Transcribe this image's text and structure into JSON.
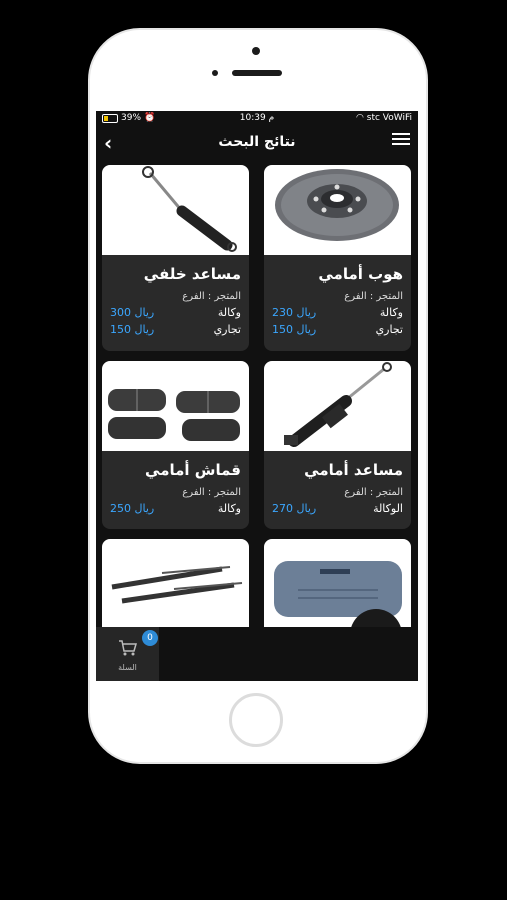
{
  "status": {
    "battery": "39%",
    "time": "10:39 م",
    "carrier": "stc VoWiFi"
  },
  "nav": {
    "title": "نتائج البحث"
  },
  "products": [
    {
      "name": "هوب أمامي",
      "store": "المتجر : الفرع",
      "prices": [
        {
          "value": "230 ريال",
          "type": "وكالة"
        },
        {
          "value": "150 ريال",
          "type": "تجاري"
        }
      ]
    },
    {
      "name": "مساعد خلفي",
      "store": "المتجر : الفرع",
      "prices": [
        {
          "value": "300 ريال",
          "type": "وكالة"
        },
        {
          "value": "150 ريال",
          "type": "تجاري"
        }
      ]
    },
    {
      "name": "مساعد أمامي",
      "store": "المتجر : الفرع",
      "prices": [
        {
          "value": "270 ريال",
          "type": "الوكالة"
        }
      ]
    },
    {
      "name": "قماش أمامي",
      "store": "المتجر : الفرع",
      "prices": [
        {
          "value": "250 ريال",
          "type": "وكالة"
        }
      ]
    }
  ],
  "cart": {
    "label": "السلة",
    "count": "0"
  }
}
